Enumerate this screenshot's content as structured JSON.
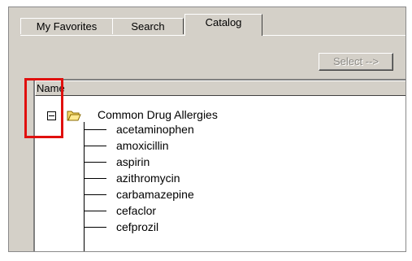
{
  "tabs": [
    {
      "label": "My Favorites",
      "active": false
    },
    {
      "label": "Search",
      "active": false
    },
    {
      "label": "Catalog",
      "active": true
    }
  ],
  "select_button": {
    "label": "Select -->",
    "enabled": false
  },
  "tree": {
    "column_header": "Name",
    "root": {
      "label": "Common Drug Allergies",
      "expanded": true,
      "children": [
        "acetaminophen",
        "amoxicillin",
        "aspirin",
        "azithromycin",
        "carbamazepine",
        "cefaclor",
        "cefprozil"
      ]
    }
  },
  "colors": {
    "highlight_border": "#e0100e",
    "panel_bg": "#d4d0c8"
  }
}
